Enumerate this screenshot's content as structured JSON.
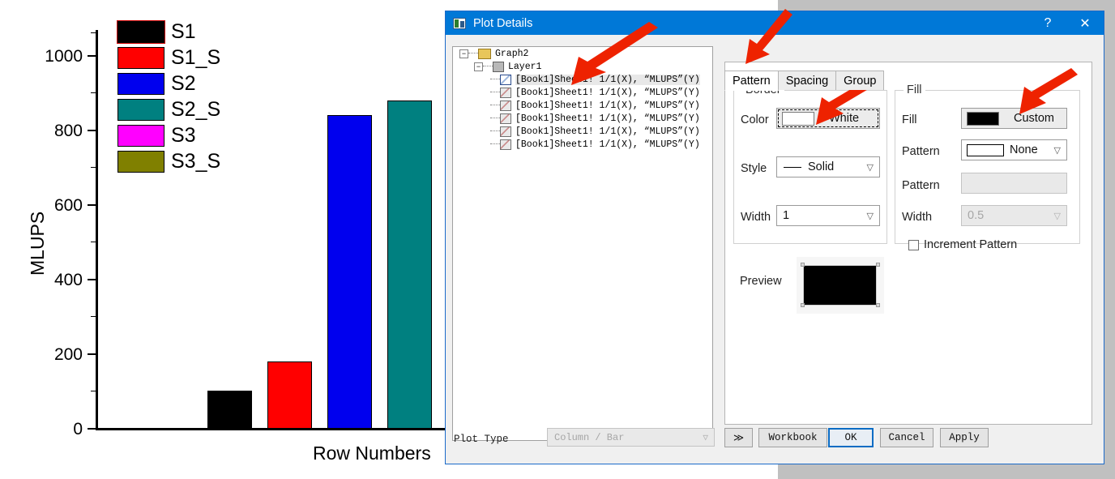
{
  "chart_data": {
    "type": "bar",
    "title": "",
    "xlabel": "Row Numbers",
    "ylabel": "MLUPS",
    "ylim": [
      0,
      1100
    ],
    "yticks": [
      0,
      200,
      400,
      600,
      800,
      1000
    ],
    "ytick_labels": [
      "0",
      "200",
      "400",
      "600",
      "800",
      "1000"
    ],
    "grid": false,
    "legend_position": "upper-left-inside",
    "categories": [
      "S1",
      "S1_S",
      "S2",
      "S2_S",
      "S3",
      "S3_S"
    ],
    "series": [
      {
        "name": "S1",
        "value": 100,
        "color": "#000000",
        "selected": true
      },
      {
        "name": "S1_S",
        "value": 180,
        "color": "#ff0000",
        "selected": false
      },
      {
        "name": "S2",
        "value": 840,
        "color": "#0000ee",
        "selected": false
      },
      {
        "name": "S2_S",
        "value": 880,
        "color": "#008080",
        "selected": false
      },
      {
        "name": "S3",
        "value": 0,
        "color": "#ff00ff",
        "selected": false
      },
      {
        "name": "S3_S",
        "value": 0,
        "color": "#808000",
        "selected": false
      }
    ]
  },
  "dialog": {
    "title": "Plot Details",
    "title_icon": "graph-window-icon",
    "help_button": "?",
    "close_button": "✕",
    "tree": {
      "root": {
        "label": "Graph2",
        "icon": "folder-icon",
        "expander": "−"
      },
      "layer": {
        "label": "Layer1",
        "icon": "layer-icon",
        "expander": "−"
      },
      "plots": [
        {
          "label": "[Book1]Sheet1! 1/1(X), “MLUPS”(Y)",
          "selected": true
        },
        {
          "label": "[Book1]Sheet1! 1/1(X), “MLUPS”(Y)",
          "selected": false
        },
        {
          "label": "[Book1]Sheet1! 1/1(X), “MLUPS”(Y)",
          "selected": false
        },
        {
          "label": "[Book1]Sheet1! 1/1(X), “MLUPS”(Y)",
          "selected": false
        },
        {
          "label": "[Book1]Sheet1! 1/1(X), “MLUPS”(Y)",
          "selected": false
        },
        {
          "label": "[Book1]Sheet1! 1/1(X), “MLUPS”(Y)",
          "selected": false
        }
      ]
    },
    "tabs": [
      {
        "label": "Pattern",
        "active": true
      },
      {
        "label": "Spacing",
        "active": false
      },
      {
        "label": "Group",
        "active": false
      }
    ],
    "border_group": {
      "title": "Border",
      "color_label": "Color",
      "color_value": "White",
      "color_swatch": "#ffffff",
      "style_label": "Style",
      "style_value": "Solid",
      "width_label": "Width",
      "width_value": "1"
    },
    "fill_group": {
      "title": "Fill",
      "fill_label": "Fill",
      "fill_value": "Custom",
      "fill_swatch": "#000000",
      "pattern_label": "Pattern",
      "pattern_value": "None",
      "pattern2_label": "Pattern",
      "pattern2_value": "",
      "width_label": "Width",
      "width_value": "0.5",
      "increment_label": "Increment Pattern",
      "increment_checked": false
    },
    "preview": {
      "label": "Preview",
      "color": "#000000"
    },
    "bottom": {
      "plot_type_label": "Plot Type",
      "plot_type_value": "Column / Bar",
      "expand_button": "≫",
      "workbook_button": "Workbook",
      "ok_button": "OK",
      "cancel_button": "Cancel",
      "apply_button": "Apply"
    }
  },
  "annotations": {
    "arrow_color": "#ee2200",
    "arrows": [
      {
        "name": "arrow-to-tree"
      },
      {
        "name": "arrow-to-pattern-tab"
      },
      {
        "name": "arrow-to-border-color"
      },
      {
        "name": "arrow-to-fill-color"
      }
    ]
  }
}
